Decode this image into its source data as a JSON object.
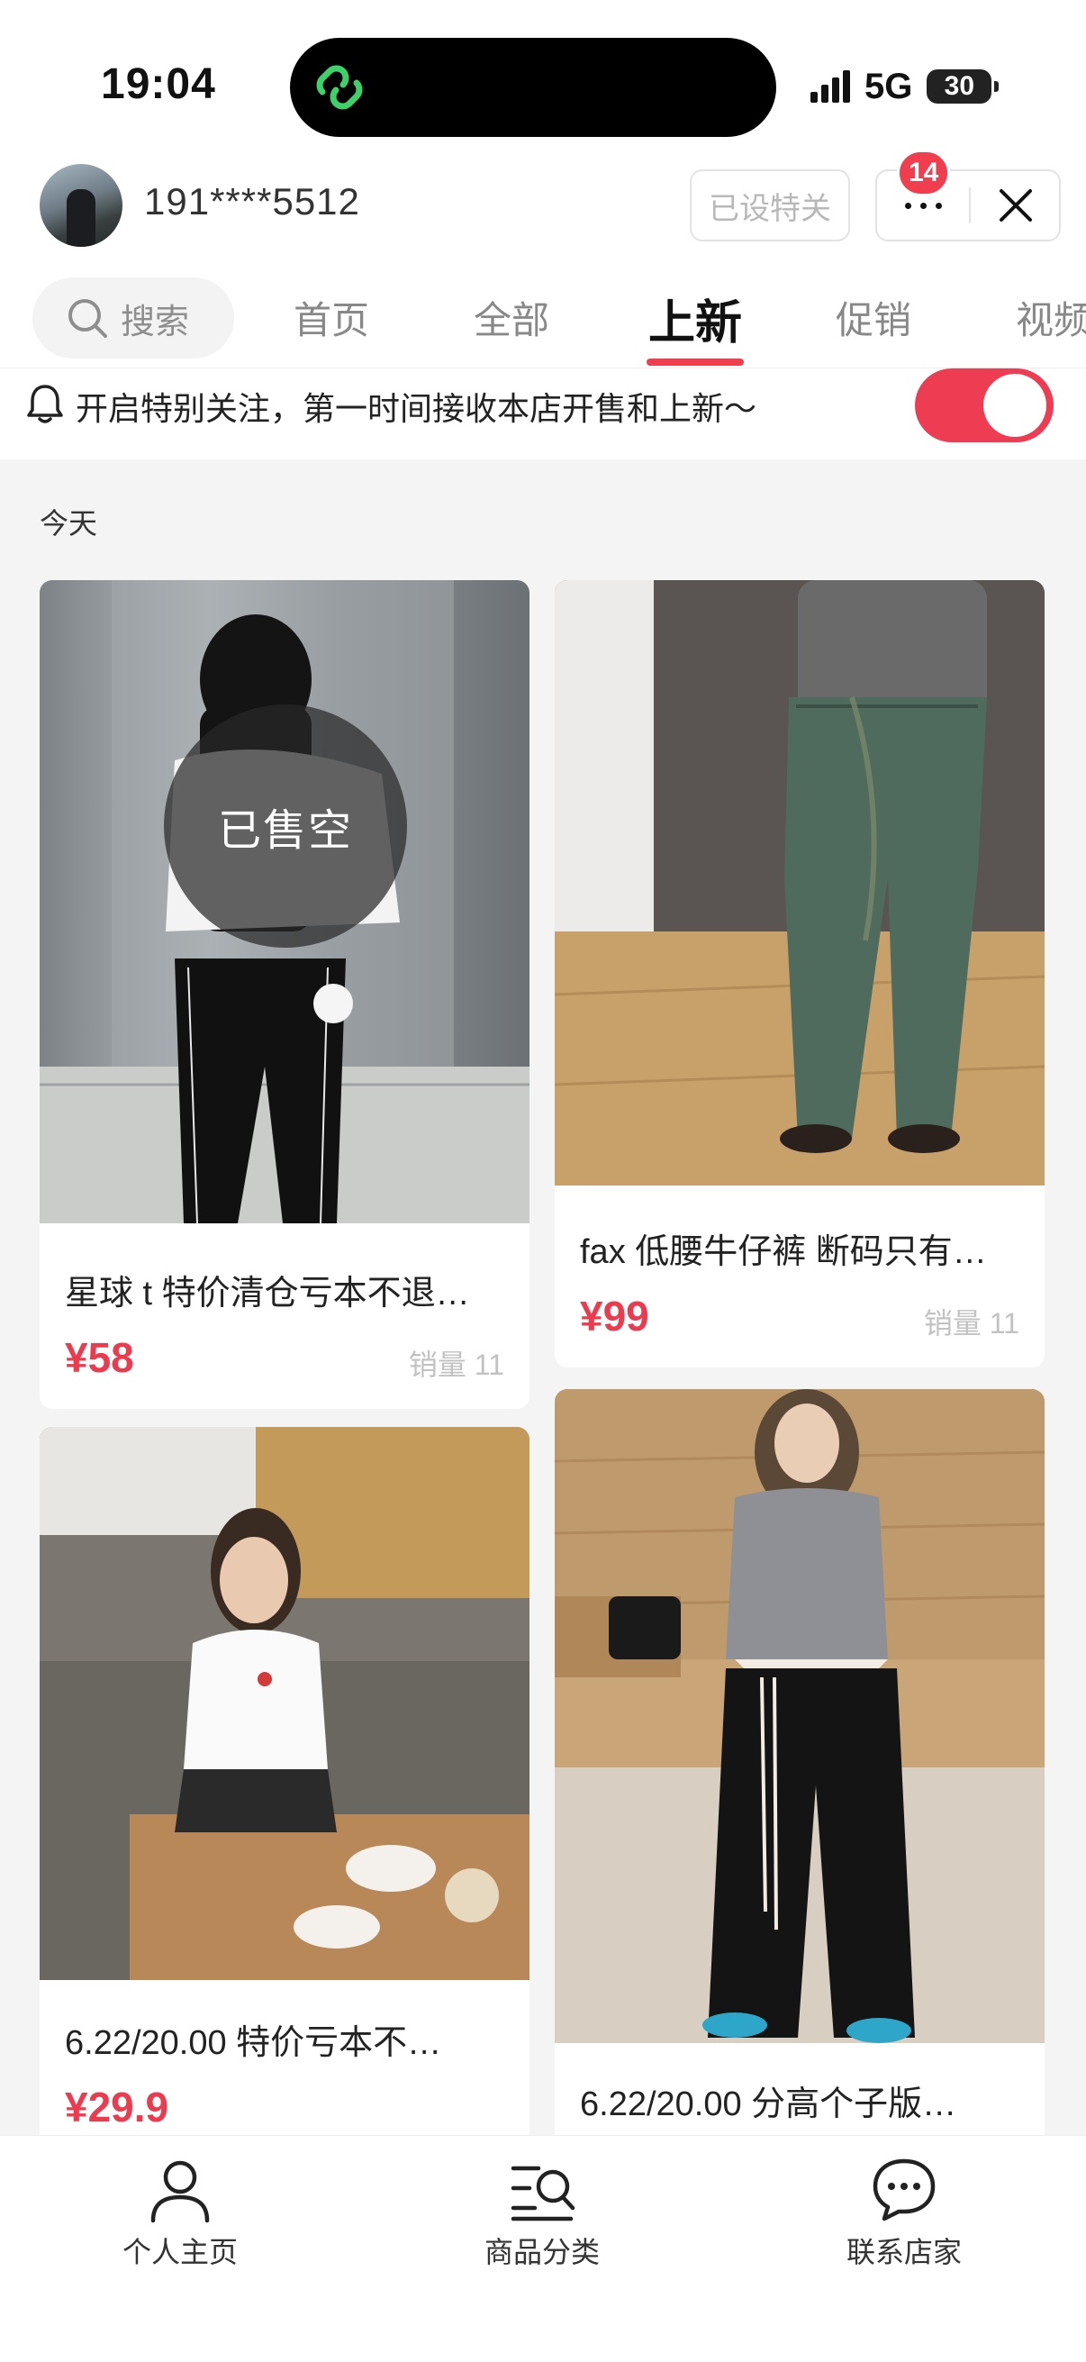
{
  "status_bar": {
    "time": "19:04",
    "network": "5G",
    "battery": "30"
  },
  "header": {
    "username": "191****5512",
    "followed_label": "已设特关",
    "badge_count": "14"
  },
  "tabs": {
    "search_label": "搜索",
    "items": [
      "首页",
      "全部",
      "上新",
      "促销",
      "视频"
    ],
    "active": "上新"
  },
  "banner": {
    "text": "开启特别关注，第一时间接收本店开售和上新～",
    "toggle_on": true
  },
  "content": {
    "section_label": "今天",
    "products": [
      {
        "title": "星球 t 特价清仓亏本不退…",
        "price": "¥58",
        "sales": "销量 11",
        "sold_out_label": "已售空"
      },
      {
        "title": "fax 低腰牛仔裤 断码只有…",
        "price": "¥99",
        "sales": "销量 11"
      },
      {
        "title": "6.22/20.00 特价亏本不…",
        "price": "¥29.9"
      },
      {
        "title": "6.22/20.00 分高个子版…"
      }
    ]
  },
  "bottom_nav": {
    "items": [
      "个人主页",
      "商品分类",
      "联系店家"
    ]
  },
  "colors": {
    "accent": "#ec3b4f",
    "toggle": "#ee3c52",
    "background": "#f4f4f4"
  }
}
